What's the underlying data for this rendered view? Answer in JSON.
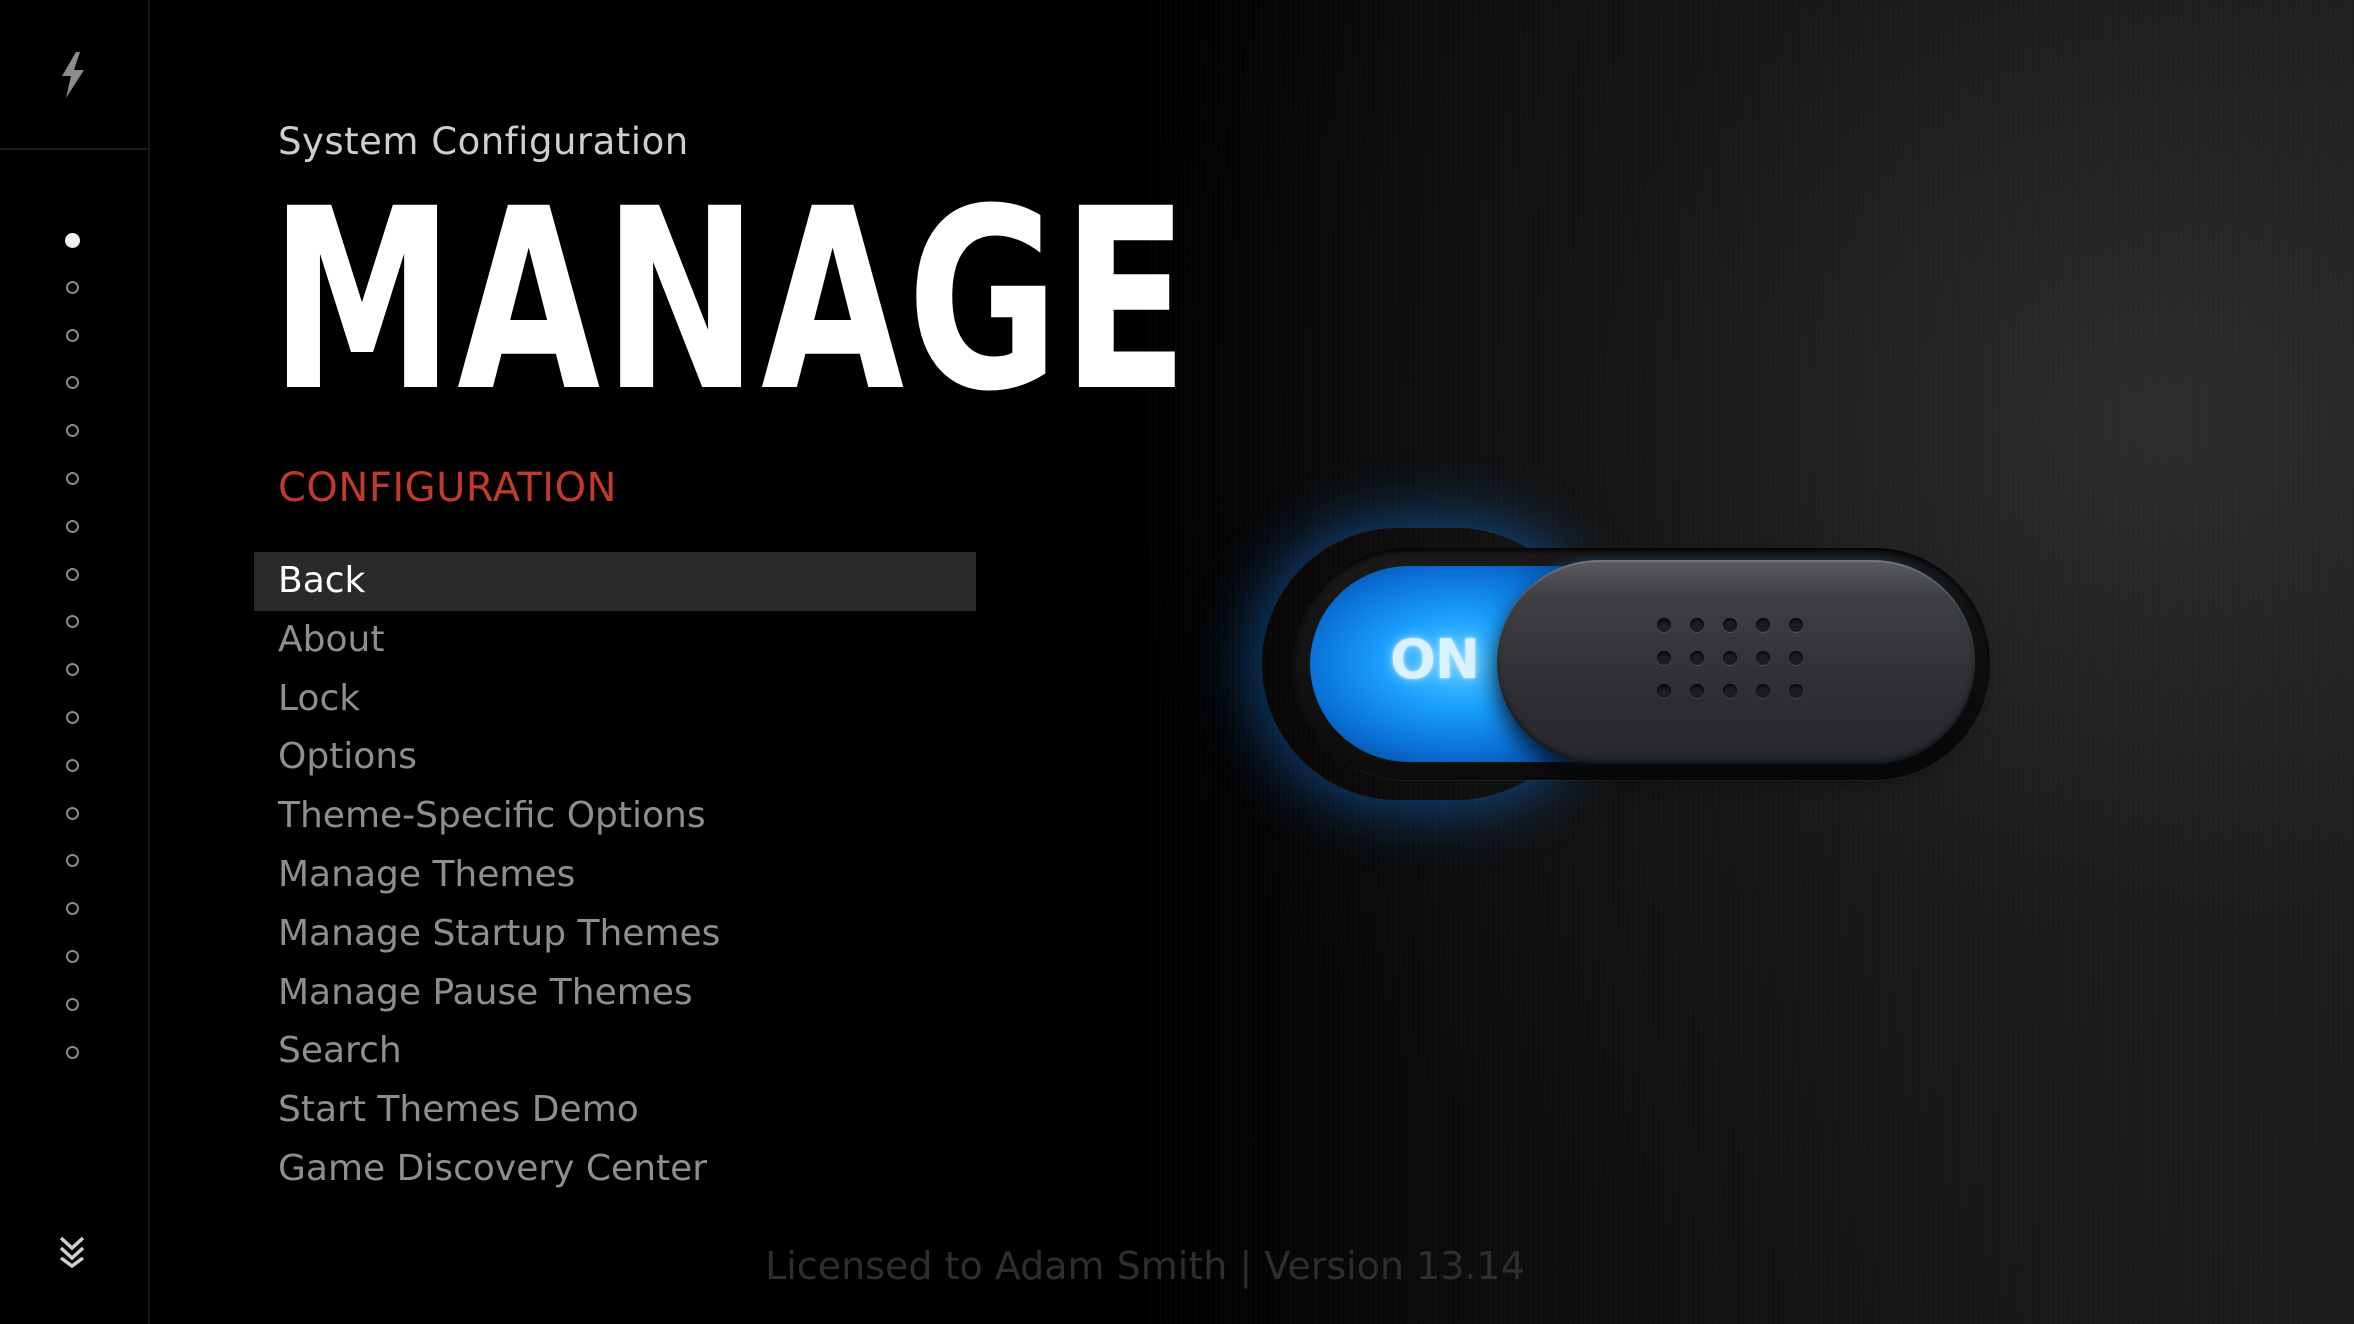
{
  "header": {
    "subtitle": "System Configuration",
    "title": "MANAGE",
    "section": "CONFIGURATION"
  },
  "sidebar": {
    "logo_icon": "lightning-bolt-icon",
    "page_count": 18,
    "active_page": 1,
    "scroll_icon": "double-chevron-down-icon"
  },
  "menu": {
    "selected_index": 0,
    "items": [
      {
        "label": "Back"
      },
      {
        "label": "About"
      },
      {
        "label": "Lock"
      },
      {
        "label": "Options"
      },
      {
        "label": "Theme-Specific Options"
      },
      {
        "label": "Manage Themes"
      },
      {
        "label": "Manage Startup Themes"
      },
      {
        "label": "Manage Pause Themes"
      },
      {
        "label": "Search"
      },
      {
        "label": "Start Themes Demo"
      },
      {
        "label": "Game Discovery Center"
      }
    ]
  },
  "toggle": {
    "state_label": "ON",
    "is_on": true
  },
  "footer": {
    "license_text": "Licensed to Adam Smith | Version 13.14"
  },
  "colors": {
    "background": "#000000",
    "accent_red": "#c2392d",
    "toggle_blue": "#1aa0ff",
    "selected_row": "#2a2a2a",
    "menu_text": "#8e8e8e"
  }
}
